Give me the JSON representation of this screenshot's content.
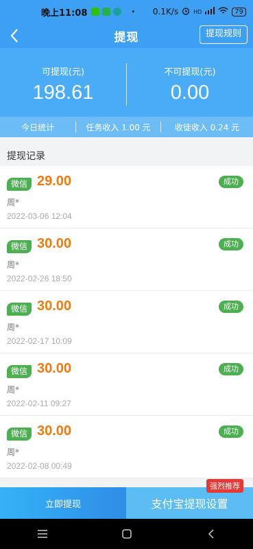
{
  "status_bar": {
    "time": "晚上11:08",
    "speed": "0.1K/s",
    "signal": "HD",
    "battery": "79"
  },
  "nav": {
    "title": "提现",
    "rules_label": "提现规则"
  },
  "balance": {
    "available_label": "可提现(元)",
    "available_value": "198.61",
    "unavailable_label": "不可提现(元)",
    "unavailable_value": "0.00"
  },
  "stats": {
    "today_label": "今日统计",
    "task_income": "任务收入 1.00 元",
    "apprentice_income": "收徒收入 0.24 元"
  },
  "records_title": "提现记录",
  "records": [
    {
      "channel": "微信",
      "amount": "29.00",
      "status": "成功",
      "name": "周*",
      "date": "2022-03-06 12:04"
    },
    {
      "channel": "微信",
      "amount": "30.00",
      "status": "成功",
      "name": "周*",
      "date": "2022-02-26 18:50"
    },
    {
      "channel": "微信",
      "amount": "30.00",
      "status": "成功",
      "name": "周*",
      "date": "2022-02-17 10:09"
    },
    {
      "channel": "微信",
      "amount": "30.00",
      "status": "成功",
      "name": "周*",
      "date": "2022-02-11 09:27"
    },
    {
      "channel": "微信",
      "amount": "30.00",
      "status": "成功",
      "name": "周*",
      "date": "2022-02-08 00:49"
    }
  ],
  "bottom": {
    "withdraw_now": "立即提现",
    "alipay_settings": "支付宝提现设置",
    "recommend_badge": "强烈推荐"
  },
  "colors": {
    "header_blue": "#3ea0f2",
    "amount_orange": "#f07a10",
    "success_green": "#4caf50",
    "badge_red": "#e53935"
  }
}
